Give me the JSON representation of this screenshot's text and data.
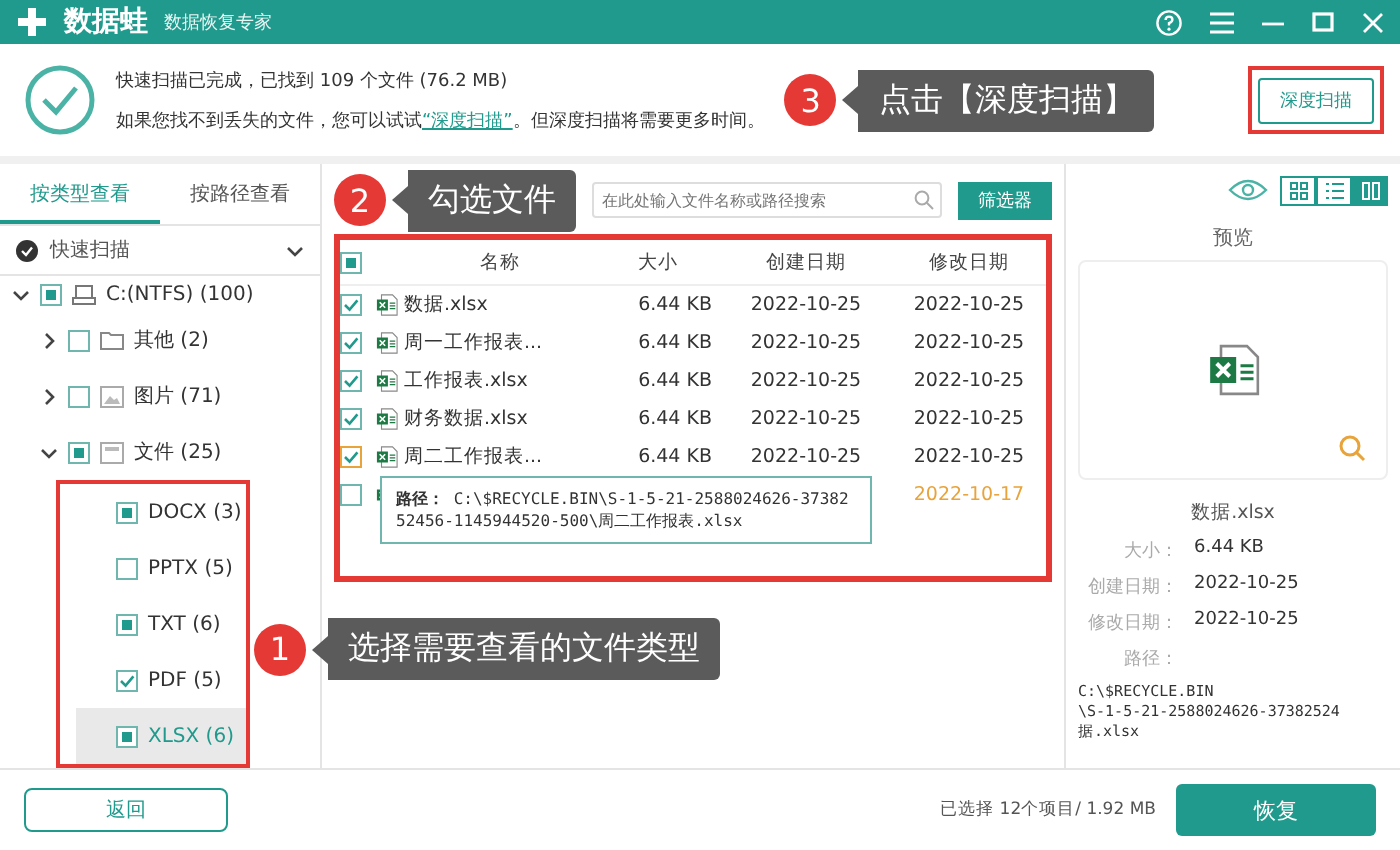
{
  "window": {
    "logo_text": "数据蛙",
    "subtitle": "数据恢复专家"
  },
  "scan_info": {
    "line1": "快速扫描已完成，已找到 109 个文件 (76.2 MB)",
    "line2_before": "如果您找不到丢失的文件，您可以试试",
    "link": "“深度扫描”",
    "line2_after": "。但深度扫描将需要更多时间。"
  },
  "deep_scan_button": {
    "label": "深度扫描",
    "highlighted": true
  },
  "view_tabs": [
    {
      "label": "按类型查看",
      "selected": true
    },
    {
      "label": "按路径查看",
      "selected": false
    }
  ],
  "scan_mode": "快速扫描",
  "tree": [
    {
      "label": "C:(NTFS) (100)",
      "kind": "drive",
      "checked": false,
      "partial": true,
      "expanded": true,
      "selected": false,
      "highlighted": false,
      "children": [
        {
          "label": "其他 (2)",
          "kind": "folder",
          "checked": false,
          "partial": false,
          "expanded": false,
          "selected": false
        },
        {
          "label": "图片 (71)",
          "kind": "image",
          "checked": false,
          "partial": false,
          "expanded": false,
          "selected": false
        },
        {
          "label": "文件 (25)",
          "kind": "document",
          "checked": false,
          "partial": true,
          "expanded": true,
          "selected": false,
          "highlighted": true,
          "children": [
            {
              "label": "DOCX (3)",
              "checked": false,
              "partial": true,
              "selected": false
            },
            {
              "label": "PPTX (5)",
              "checked": false,
              "partial": false,
              "selected": false
            },
            {
              "label": "TXT (6)",
              "checked": false,
              "partial": true,
              "selected": false
            },
            {
              "label": "PDF (5)",
              "checked": true,
              "partial": false,
              "selected": false
            },
            {
              "label": "XLSX (6)",
              "checked": false,
              "partial": true,
              "selected": true
            }
          ]
        }
      ]
    }
  ],
  "search": {
    "placeholder": "在此处输入文件名称或路径搜索"
  },
  "filter_button": "筛选器",
  "view_modes": [
    {
      "kind": "grid",
      "selected": false
    },
    {
      "kind": "list",
      "selected": false
    },
    {
      "kind": "detail",
      "selected": true
    }
  ],
  "table": {
    "highlighted": true,
    "all_checked": false,
    "all_partial": true,
    "columns": [
      "名称",
      "大小",
      "创建日期",
      "修改日期"
    ],
    "rows": [
      {
        "checked": true,
        "hovered": false,
        "flagged": false,
        "name": "数据.xlsx",
        "size": "6.44 KB",
        "created": "2022-10-25",
        "modified": "2022-10-25"
      },
      {
        "checked": true,
        "hovered": false,
        "flagged": false,
        "name": "周一工作报表...",
        "size": "6.44 KB",
        "created": "2022-10-25",
        "modified": "2022-10-25"
      },
      {
        "checked": true,
        "hovered": false,
        "flagged": false,
        "name": "工作报表.xlsx",
        "size": "6.44 KB",
        "created": "2022-10-25",
        "modified": "2022-10-25"
      },
      {
        "checked": true,
        "hovered": false,
        "flagged": false,
        "name": "财务数据.xlsx",
        "size": "6.44 KB",
        "created": "2022-10-25",
        "modified": "2022-10-25"
      },
      {
        "checked": true,
        "hovered": true,
        "flagged": false,
        "name": "周二工作报表...",
        "size": "6.44 KB",
        "created": "2022-10-25",
        "modified": "2022-10-25"
      },
      {
        "checked": false,
        "hovered": false,
        "flagged": true,
        "modified": "2022-10-17"
      }
    ]
  },
  "tooltip": {
    "label": "路径：",
    "path": "C:\\$RECYCLE.BIN\\S-1-5-21-2588024626-3738252456-1145944520-500\\周二工作报表.xlsx"
  },
  "preview": {
    "title": "预览",
    "file_name": "数据.xlsx",
    "details": [
      {
        "label": "大小：",
        "value": "6.44 KB"
      },
      {
        "label": "创建日期：",
        "value": "2022-10-25"
      },
      {
        "label": "修改日期：",
        "value": "2022-10-25"
      }
    ],
    "path_label": "路径：",
    "path_lines": [
      "C:\\$RECYCLE.BIN",
      "\\S-1-5-21-2588024626-37382524",
      "据.xlsx"
    ]
  },
  "footer": {
    "back": "返回",
    "summary": "已选择 12个项目/ 1.92 MB",
    "recover": "恢复"
  },
  "callouts": [
    {
      "number": "3",
      "text": "点击【深度扫描】"
    },
    {
      "number": "2",
      "text": "勾选文件"
    },
    {
      "number": "1",
      "text": "选择需要查看的文件类型"
    }
  ]
}
